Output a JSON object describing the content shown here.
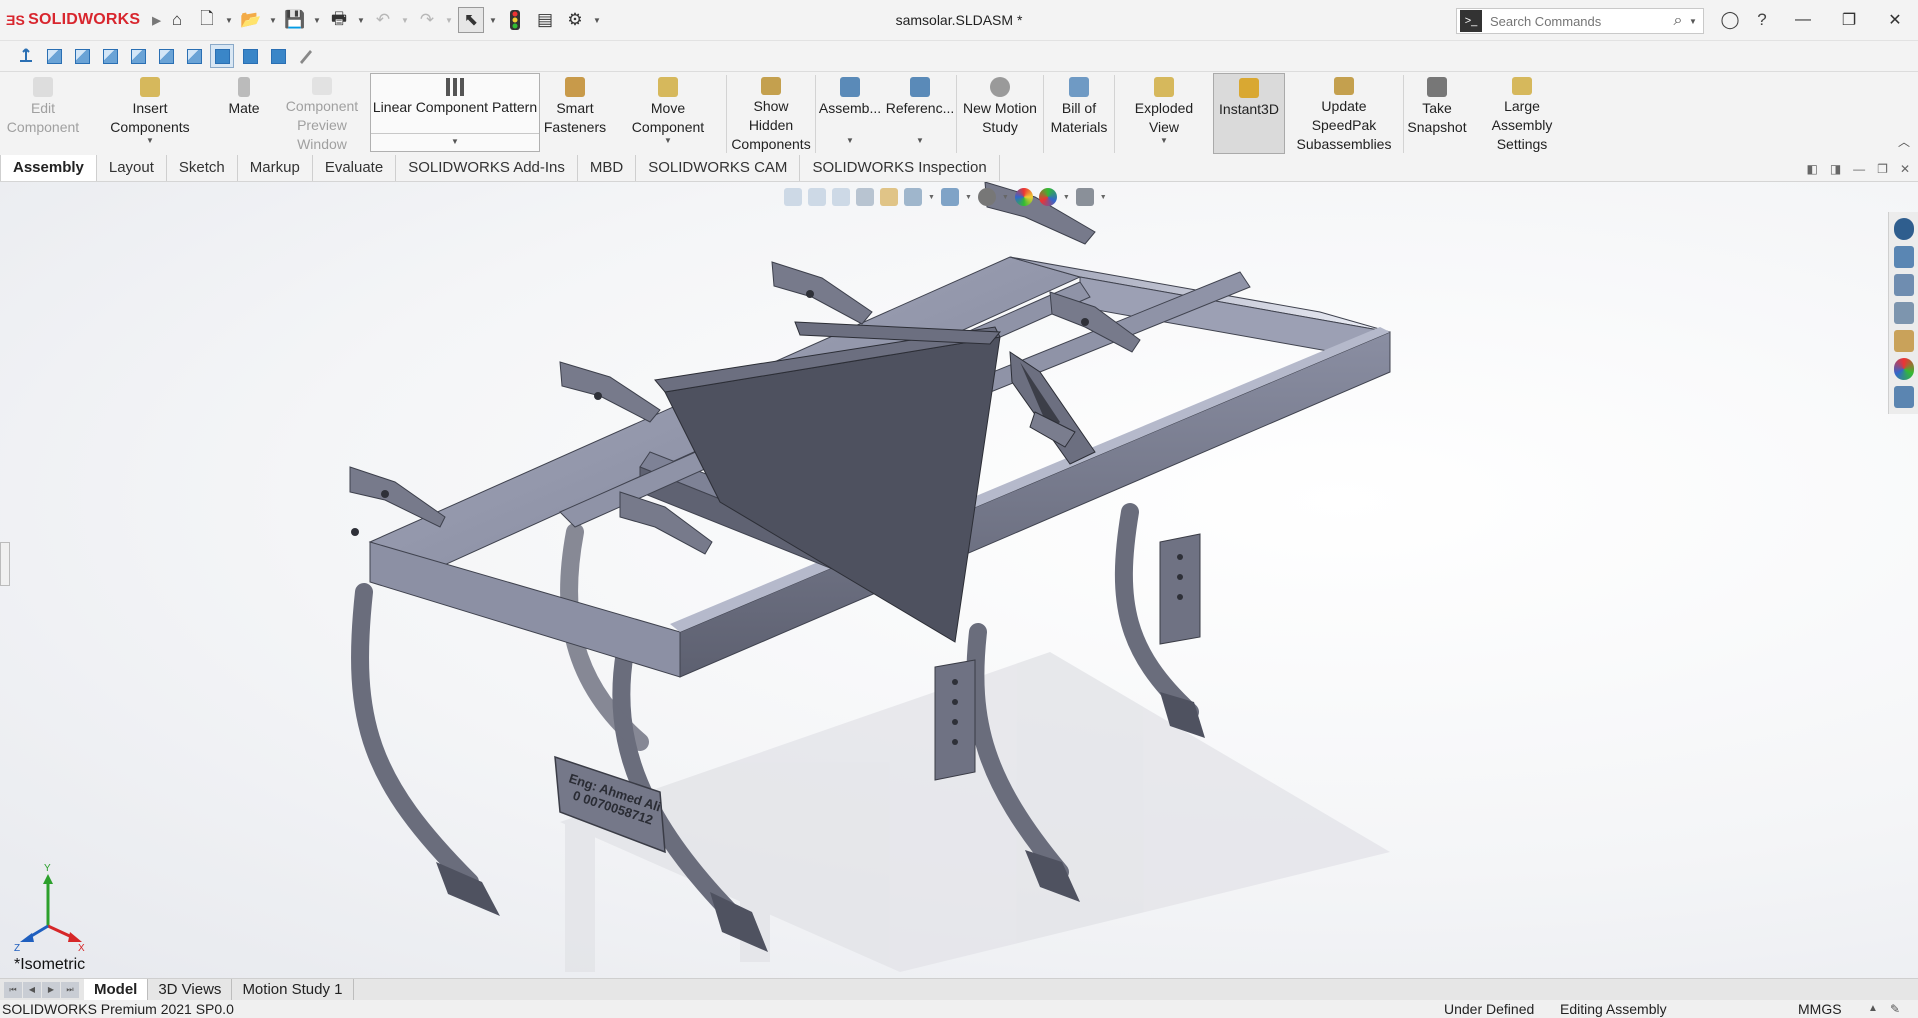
{
  "app": {
    "brand": "SOLIDWORKS",
    "document_title": "samsolar.SLDASM *"
  },
  "search": {
    "placeholder": "Search Commands"
  },
  "command_manager": {
    "edit_component": "Edit Component",
    "insert_components": "Insert Components",
    "mate": "Mate",
    "component_preview_window": "Component Preview Window",
    "linear_component_pattern": "Linear Component Pattern",
    "smart_fasteners": "Smart Fasteners",
    "move_component": "Move Component",
    "show_hidden_components": "Show Hidden Components",
    "assembly_features": "Assemb...",
    "reference_geometry": "Referenc...",
    "new_motion_study": "New Motion Study",
    "bill_of_materials": "Bill of Materials",
    "exploded_view": "Exploded View",
    "instant3d": "Instant3D",
    "update_speedpak": "Update SpeedPak Subassemblies",
    "take_snapshot": "Take Snapshot",
    "large_assembly_settings": "Large Assembly Settings"
  },
  "tabs": [
    "Assembly",
    "Layout",
    "Sketch",
    "Markup",
    "Evaluate",
    "SOLIDWORKS Add-Ins",
    "MBD",
    "SOLIDWORKS CAM",
    "SOLIDWORKS Inspection"
  ],
  "graphics": {
    "view_name": "*Isometric",
    "plate_text_line1": "Eng: Ahmed Ali",
    "plate_text_line2": "0 0070058712",
    "triad_x": "X",
    "triad_y": "Y",
    "triad_z": "Z"
  },
  "bottom_tabs": [
    "Model",
    "3D Views",
    "Motion Study 1"
  ],
  "status": {
    "product": "SOLIDWORKS Premium 2021 SP0.0",
    "defined": "Under Defined",
    "mode": "Editing Assembly",
    "units": "MMGS"
  },
  "colors": {
    "brand_red": "#d8262e",
    "part_fill": "#8e92a6",
    "part_dark": "#50535f",
    "accent_blue": "#2a6fb3"
  },
  "icons": {
    "home": "home-icon",
    "new": "new-document-icon",
    "open": "open-folder-icon",
    "save": "save-icon",
    "print": "print-icon",
    "undo": "undo-icon",
    "redo": "redo-icon",
    "select": "select-arrow-icon",
    "rebuild": "traffic-light-icon",
    "file_properties": "file-properties-icon",
    "options": "gear-icon"
  }
}
